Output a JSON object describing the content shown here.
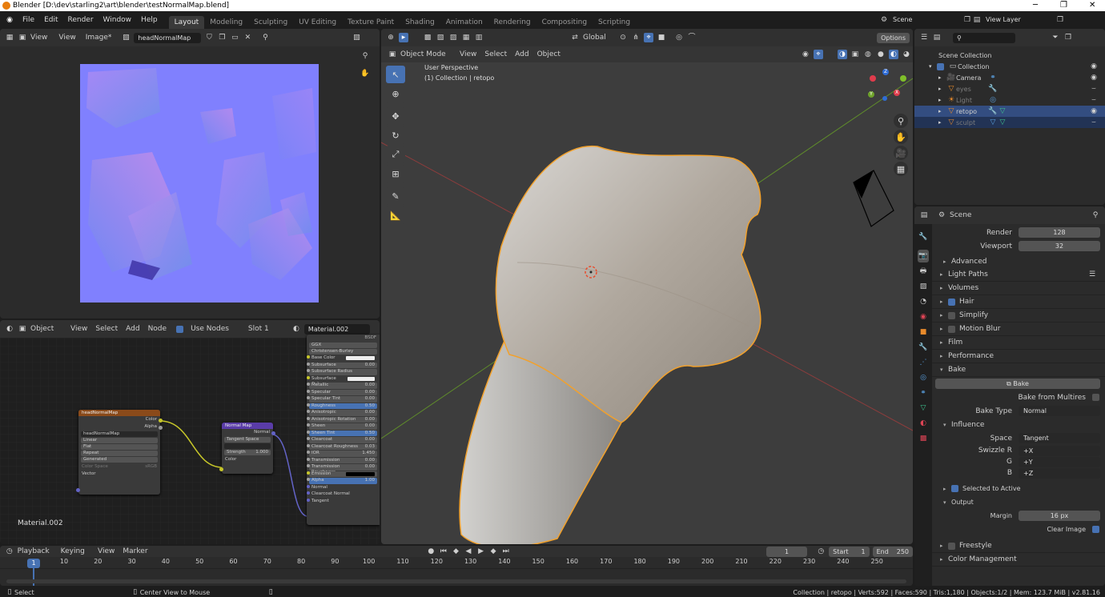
{
  "window": {
    "title": "Blender [D:\\dev\\starling2\\art\\blender\\testNormalMap.blend]",
    "min": "─",
    "max": "❐",
    "close": "✕"
  },
  "menu": [
    "File",
    "Edit",
    "Render",
    "Window",
    "Help"
  ],
  "workspaces": [
    "Layout",
    "Modeling",
    "Sculpting",
    "UV Editing",
    "Texture Paint",
    "Shading",
    "Animation",
    "Rendering",
    "Compositing",
    "Scripting"
  ],
  "active_workspace": "Layout",
  "scene_name": "Scene",
  "view_layer": "View Layer",
  "image_editor": {
    "view": "View",
    "view2": "View",
    "image": "Image*",
    "image_name": "headNormalMap"
  },
  "node_editor": {
    "type": "Object",
    "view": "View",
    "select": "Select",
    "add": "Add",
    "node": "Node",
    "use_nodes": "Use Nodes",
    "slot": "Slot 1",
    "material": "Material.002",
    "footer_label": "Material.002"
  },
  "texture_node": {
    "title": "headNormalMap",
    "out_color": "Color",
    "out_alpha": "Alpha",
    "image": "headNormalMap",
    "interp": "Linear",
    "proj": "Flat",
    "ext": "Repeat",
    "source": "Generated",
    "cs_label": "Color Space",
    "cs": "sRGB",
    "vector": "Vector"
  },
  "normal_node": {
    "title": "Normal Map",
    "out": "Normal",
    "space": "Tangent Space",
    "strength_label": "Strength",
    "strength": "1.000",
    "color": "Color"
  },
  "bsdf_node": {
    "head": "BSDF",
    "dist": "GGX",
    "sss": "Christensen-Burley",
    "rows": [
      {
        "l": "Base Color",
        "v": ""
      },
      {
        "l": "Subsurface",
        "v": "0.00"
      },
      {
        "l": "Subsurface Radius",
        "v": ""
      },
      {
        "l": "Subsurface Color",
        "v": ""
      },
      {
        "l": "Metallic",
        "v": "0.00"
      },
      {
        "l": "Specular",
        "v": "0.00"
      },
      {
        "l": "Specular Tint",
        "v": "0.00"
      },
      {
        "l": "Roughness",
        "v": "0.50"
      },
      {
        "l": "Anisotropic",
        "v": "0.00"
      },
      {
        "l": "Anisotropic Rotation",
        "v": "0.00"
      },
      {
        "l": "Sheen",
        "v": "0.00"
      },
      {
        "l": "Sheen Tint",
        "v": "0.50"
      },
      {
        "l": "Clearcoat",
        "v": "0.00"
      },
      {
        "l": "Clearcoat Roughness",
        "v": "0.03"
      },
      {
        "l": "IOR",
        "v": "1.450"
      },
      {
        "l": "Transmission",
        "v": "0.00"
      },
      {
        "l": "Transmission Roughness",
        "v": "0.00"
      },
      {
        "l": "Emission",
        "v": ""
      },
      {
        "l": "Alpha",
        "v": "1.00"
      },
      {
        "l": "Normal",
        "v": ""
      },
      {
        "l": "Clearcoat Normal",
        "v": ""
      },
      {
        "l": "Tangent",
        "v": ""
      }
    ]
  },
  "viewport": {
    "mode": "Object Mode",
    "view": "View",
    "select": "Select",
    "add": "Add",
    "object": "Object",
    "orientation": "Global",
    "options": "Options",
    "overlay1": "User Perspective",
    "overlay2": "(1) Collection | retopo"
  },
  "gizmo": {
    "x": "X",
    "y": "Y",
    "z": "Z"
  },
  "outliner": {
    "root": "Scene Collection",
    "collection": "Collection",
    "items": [
      {
        "name": "Camera",
        "dim": false,
        "sel": false
      },
      {
        "name": "eyes",
        "dim": true,
        "sel": false
      },
      {
        "name": "Light",
        "dim": true,
        "sel": false
      },
      {
        "name": "retopo",
        "dim": false,
        "sel": true
      },
      {
        "name": "sculpt",
        "dim": true,
        "sel": false
      }
    ]
  },
  "properties": {
    "scene": "Scene",
    "render_label": "Render",
    "render": "128",
    "viewport_label": "Viewport",
    "viewport": "32",
    "advanced": "Advanced",
    "sections": [
      "Light Paths",
      "Volumes",
      "Hair",
      "Simplify",
      "Motion Blur",
      "Film",
      "Performance",
      "Bake"
    ],
    "bake_button": "Bake",
    "bake_from_multires": "Bake from Multires",
    "bake_type_label": "Bake Type",
    "bake_type": "Normal",
    "influence": "Influence",
    "space_label": "Space",
    "space": "Tangent",
    "swizzle_r_label": "Swizzle R",
    "swizzle_r": "+X",
    "g_label": "G",
    "g": "+Y",
    "b_label": "B",
    "b": "+Z",
    "selected_to_active": "Selected to Active",
    "output": "Output",
    "margin_label": "Margin",
    "margin": "16 px",
    "clear_image": "Clear Image",
    "freestyle": "Freestyle",
    "color_management": "Color Management"
  },
  "timeline": {
    "playback": "Playback",
    "keying": "Keying",
    "view": "View",
    "marker": "Marker",
    "current": "1",
    "start_label": "Start",
    "start": "1",
    "end_label": "End",
    "end": "250",
    "ticks": [
      "10",
      "20",
      "30",
      "40",
      "50",
      "60",
      "70",
      "80",
      "90",
      "100",
      "110",
      "120",
      "130",
      "140",
      "150",
      "160",
      "170",
      "180",
      "190",
      "200",
      "210",
      "220",
      "230",
      "240",
      "250"
    ]
  },
  "status": {
    "select": "Select",
    "center": "Center View to Mouse",
    "info": "Collection | retopo | Verts:592 | Faces:590 | Tris:1,180 | Objects:1/2 | Mem: 123.7 MiB | v2.81.16"
  }
}
